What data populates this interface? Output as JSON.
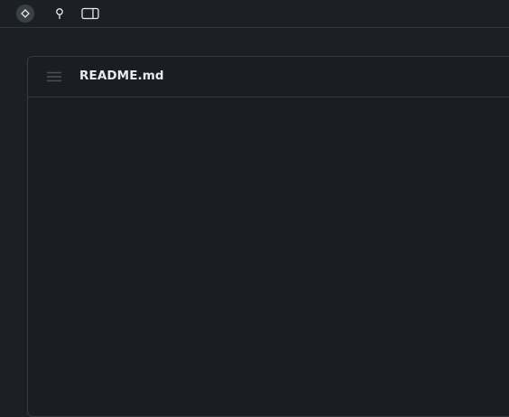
{
  "toolbar": {
    "buttons": [
      {
        "icon": "diamond-icon"
      },
      {
        "icon": "pin-icon"
      },
      {
        "icon": "sidebar-panel-icon"
      }
    ]
  },
  "file": {
    "name": "README.md",
    "menu_icon": "hamburger-menu-icon"
  },
  "colors": {
    "background": "#1c2025",
    "panel": "#1a1e23",
    "border": "#353b42",
    "text": "#e8eaed",
    "icon": "#d0d4d9"
  }
}
